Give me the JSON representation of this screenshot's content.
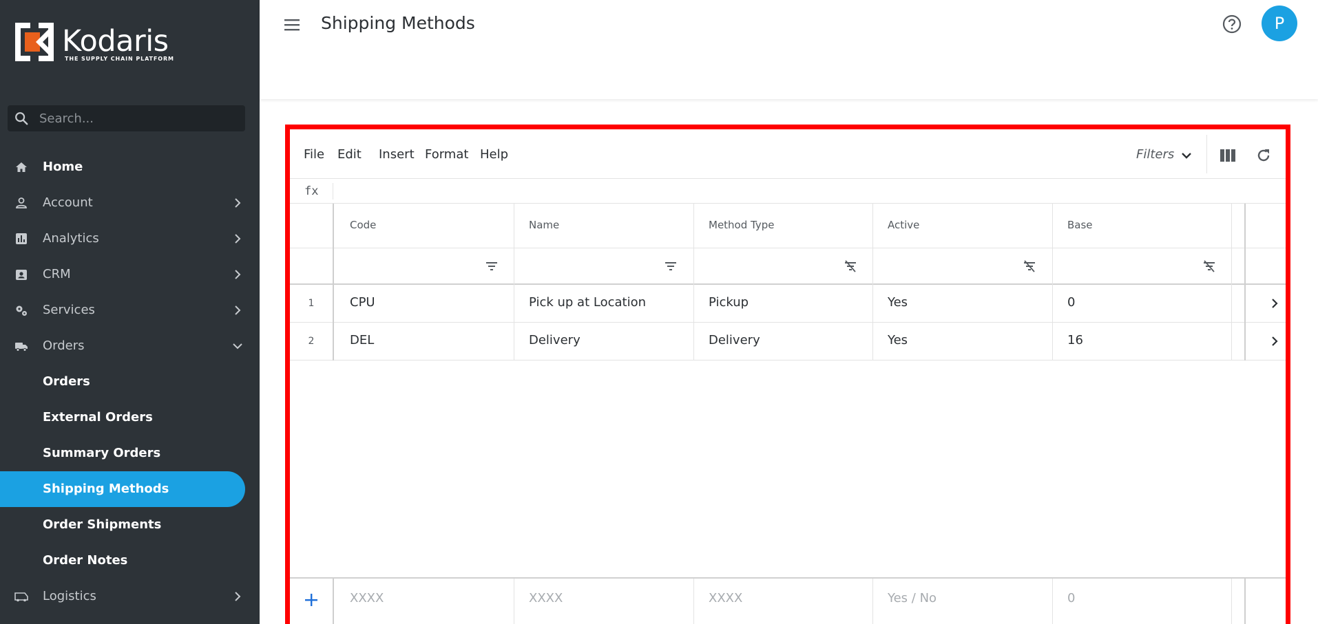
{
  "brand": {
    "name": "Kodaris",
    "tagline": "THE SUPPLY CHAIN PLATFORM"
  },
  "search": {
    "placeholder": "Search..."
  },
  "nav": {
    "home": "Home",
    "account": "Account",
    "analytics": "Analytics",
    "crm": "CRM",
    "services": "Services",
    "orders": "Orders",
    "orders_sub": [
      "Orders",
      "External Orders",
      "Summary Orders",
      "Shipping Methods",
      "Order Shipments",
      "Order Notes"
    ],
    "logistics": "Logistics"
  },
  "header": {
    "title": "Shipping Methods",
    "avatar_initial": "P"
  },
  "toolbar": {
    "menus": [
      "File",
      "Edit",
      "Insert",
      "Format",
      "Help"
    ],
    "filters_label": "Filters"
  },
  "formula": {
    "label": "fx"
  },
  "table": {
    "columns": [
      "Code",
      "Name",
      "Method Type",
      "Active",
      "Base"
    ],
    "rows": [
      {
        "num": "1",
        "code": "CPU",
        "name": "Pick up at Location",
        "method_type": "Pickup",
        "active": "Yes",
        "base": "0"
      },
      {
        "num": "2",
        "code": "DEL",
        "name": "Delivery",
        "method_type": "Delivery",
        "active": "Yes",
        "base": "16"
      }
    ],
    "new_row_placeholders": {
      "code": "XXXX",
      "name": "XXXX",
      "method_type": "XXXX",
      "active": "Yes / No",
      "base": "0"
    }
  },
  "colors": {
    "sidebar": "#2d3338",
    "accent": "#1ba1e2",
    "highlight_border": "#ff0000"
  }
}
